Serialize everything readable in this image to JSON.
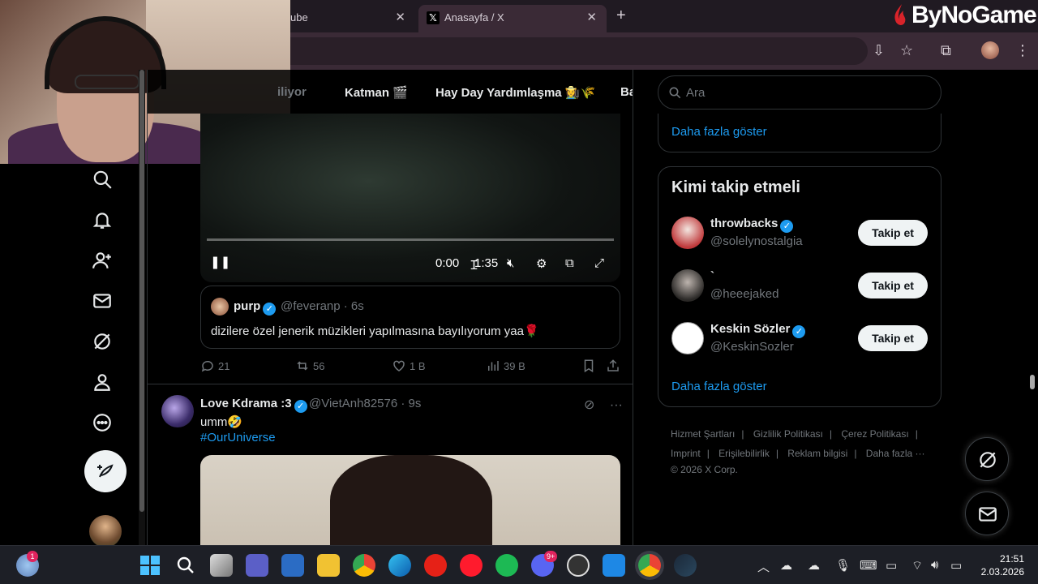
{
  "browser": {
    "tabs": [
      {
        "title": "ube",
        "active": false
      },
      {
        "title": "Anasayfa / X",
        "active": true
      }
    ],
    "new_tab": "+",
    "close": "✕"
  },
  "overlay_logo": "ByNoGame",
  "topnav": {
    "items": [
      "iliyor",
      "Katman 🎬",
      "Hay Day Yardımlaşma 👩‍🌾🌾",
      "Ba"
    ]
  },
  "video": {
    "time": "0:00",
    "duration": "1:35"
  },
  "quote": {
    "name": "purp",
    "meta": "@feveranp · 6s",
    "text": "dizilere özel jenerik müzikleri yapılmasına bayılıyorum yaa🌹"
  },
  "actions": {
    "replies": "21",
    "reposts": "56",
    "likes": "1 B",
    "views": "39 B"
  },
  "tweet2": {
    "name": "Love Kdrama :3",
    "meta": "@VietAnh82576 · 9s",
    "text": "umm🤣",
    "hashtag": "#OurUniverse",
    "more": "···"
  },
  "search": {
    "placeholder": "Ara"
  },
  "card_more": "Daha fazla göster",
  "who_to_follow": {
    "title": "Kimi takip etmeli",
    "users": [
      {
        "name": "throwbacks",
        "handle": "@solelynostalgia",
        "verified": true,
        "button": "Takip et"
      },
      {
        "name": "`",
        "handle": "@heeejaked",
        "verified": false,
        "button": "Takip et"
      },
      {
        "name": "Keskin Sözler",
        "handle": "@KeskinSozler",
        "verified": true,
        "button": "Takip et"
      }
    ],
    "more": "Daha fazla göster"
  },
  "footer": {
    "links": [
      "Hizmet Şartları",
      "Gizlilik Politikası",
      "Çerez Politikası",
      "Imprint",
      "Erişilebilirlik",
      "Reklam bilgisi",
      "Daha fazla ···"
    ],
    "copyright": "© 2026 X Corp."
  },
  "taskbar": {
    "time": "21:51",
    "date": "2.03.2026",
    "weather_badge": "1",
    "discord_badge": "9+"
  },
  "colors": {
    "accent": "#1d9bf0",
    "background": "#000000",
    "muted": "#71767b",
    "chrome": "#3a2a36"
  }
}
